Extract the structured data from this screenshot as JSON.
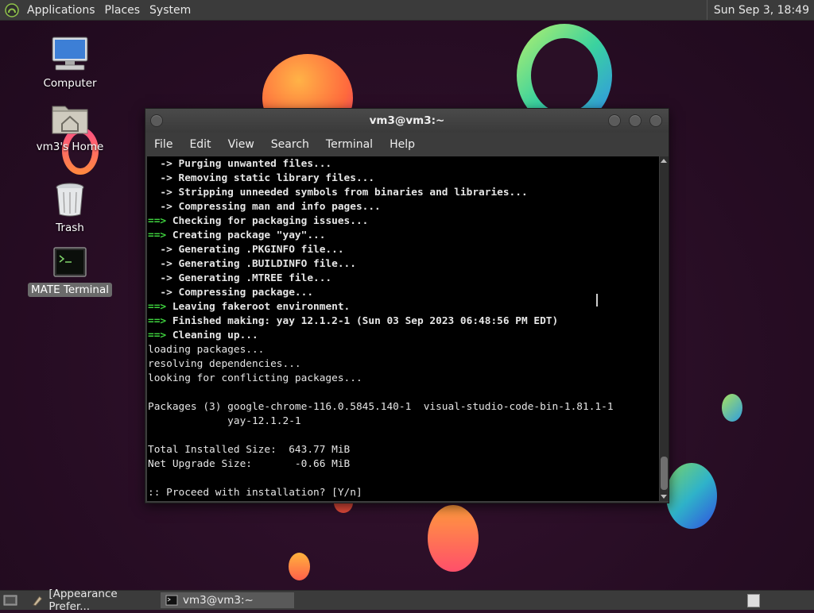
{
  "top_panel": {
    "menus": [
      "Applications",
      "Places",
      "System"
    ],
    "clock": "Sun Sep  3, 18:49"
  },
  "desktop_icons": [
    {
      "label": "Computer",
      "icon": "computer-icon"
    },
    {
      "label": "vm3's Home",
      "icon": "home-folder-icon"
    },
    {
      "label": "Trash",
      "icon": "trash-icon"
    },
    {
      "label": "MATE Terminal",
      "icon": "terminal-icon"
    }
  ],
  "window": {
    "title": "vm3@vm3:~",
    "menu": [
      "File",
      "Edit",
      "View",
      "Search",
      "Terminal",
      "Help"
    ]
  },
  "terminal_lines": [
    "  -> Purging unwanted files...",
    "  -> Removing static library files...",
    "  -> Stripping unneeded symbols from binaries and libraries...",
    "  -> Compressing man and info pages...",
    "==> Checking for packaging issues...",
    "==> Creating package \"yay\"...",
    "  -> Generating .PKGINFO file...",
    "  -> Generating .BUILDINFO file...",
    "  -> Generating .MTREE file...",
    "  -> Compressing package...",
    "==> Leaving fakeroot environment.",
    "==> Finished making: yay 12.1.2-1 (Sun 03 Sep 2023 06:48:56 PM EDT)",
    "==> Cleaning up...",
    "loading packages...",
    "resolving dependencies...",
    "looking for conflicting packages...",
    "",
    "Packages (3) google-chrome-116.0.5845.140-1  visual-studio-code-bin-1.81.1-1",
    "             yay-12.1.2-1",
    "",
    "Total Installed Size:  643.77 MiB",
    "Net Upgrade Size:       -0.66 MiB",
    "",
    ":: Proceed with installation? [Y/n]"
  ],
  "taskbar": {
    "tasks": [
      {
        "label": "[Appearance Prefer...",
        "active": false
      },
      {
        "label": "vm3@vm3:~",
        "active": true
      }
    ]
  },
  "colors": {
    "arrow_green": "#3fd43f",
    "terminal_bg": "#000000",
    "panel_bg": "#3b3b3b"
  }
}
